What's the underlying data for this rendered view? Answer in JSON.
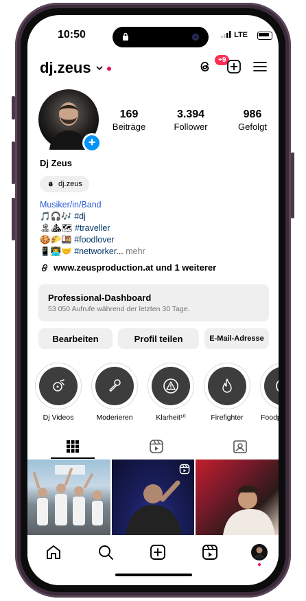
{
  "status_bar": {
    "time": "10:50",
    "network": "LTE"
  },
  "header": {
    "username": "dj.zeus",
    "threads_badge": "+9"
  },
  "profile": {
    "full_name": "Dj Zeus",
    "threads_handle": "dj.zeus",
    "stats": [
      {
        "value": "169",
        "label": "Beiträge"
      },
      {
        "value": "3.394",
        "label": "Follower"
      },
      {
        "value": "986",
        "label": "Gefolgt"
      }
    ],
    "bio": {
      "category": "Musiker/in/Band",
      "line1_emoji": "🎵🎧🎶",
      "line1_tag": "#dj",
      "line2_emoji": "🏝⛰🗺",
      "line2_tag": "#traveller",
      "line3_emoji": "🍪🌮🍱",
      "line3_tag": "#foodlover",
      "line4_emoji": "📱👨‍💻🤝",
      "line4_tag": "#networker",
      "ellipsis": "...",
      "more": " mehr"
    },
    "website": "www.zeusproduction.at und 1 weiterer"
  },
  "dashboard": {
    "title": "Professional-Dashboard",
    "subtitle": "53 050 Aufrufe während der letzten 30 Tage."
  },
  "buttons": {
    "edit": "Bearbeiten",
    "share": "Profil teilen",
    "email": "E-Mail-Adresse"
  },
  "highlights": [
    {
      "label": "Dj Videos",
      "icon": "dj-icon"
    },
    {
      "label": "Moderieren",
      "icon": "microphone-icon"
    },
    {
      "label": "Klarheit¹⁰",
      "icon": "warning-icon"
    },
    {
      "label": "Firefighter",
      "icon": "flame-icon"
    },
    {
      "label": "Foodpo",
      "icon": "warning-icon"
    }
  ],
  "colors": {
    "accent": "#0095f6",
    "badge": "#ff2d55",
    "link": "#00376b",
    "category": "#2a5bd7"
  }
}
